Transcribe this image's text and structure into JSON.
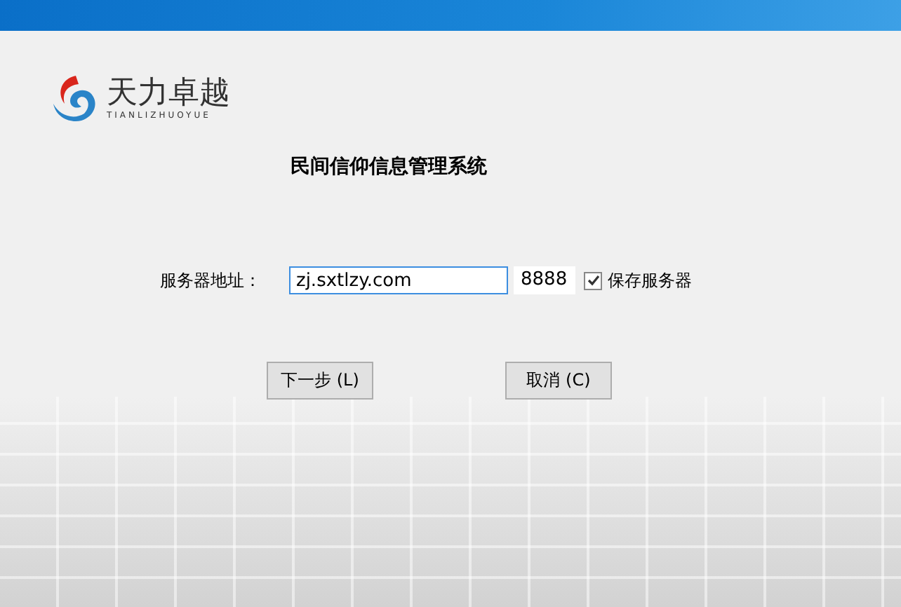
{
  "logo": {
    "name": "天力卓越",
    "subtitle": "TIANLIZHUOYUE"
  },
  "title": "民间信仰信息管理系统",
  "server": {
    "label": "服务器地址：",
    "address": "zj.sxtlzy.com",
    "port": "8888",
    "save_checkbox": {
      "label": "保存服务器",
      "checked": true
    }
  },
  "buttons": [
    {
      "label": "下一步 (L)"
    },
    {
      "label": "取消 (C)"
    }
  ]
}
